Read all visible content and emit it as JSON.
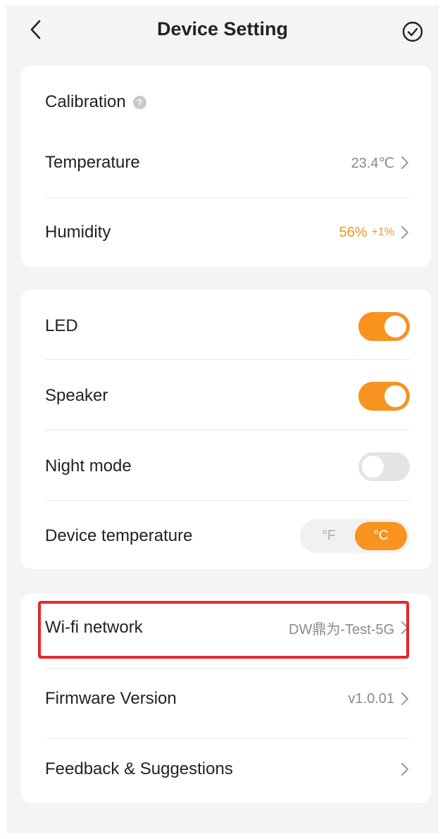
{
  "header": {
    "title": "Device Setting",
    "back_icon": "chevron-left-icon",
    "confirm_icon": "check-circle-icon"
  },
  "calibration": {
    "title": "Calibration",
    "help_icon": "?",
    "temperature": {
      "label": "Temperature",
      "value": "23.4℃"
    },
    "humidity": {
      "label": "Humidity",
      "value": "56%",
      "delta": "+1%"
    }
  },
  "controls": {
    "led": {
      "label": "LED",
      "on": true
    },
    "speaker": {
      "label": "Speaker",
      "on": true
    },
    "night_mode": {
      "label": "Night mode",
      "on": false
    },
    "device_temperature": {
      "label": "Device temperature",
      "options": [
        "°F",
        "°C"
      ],
      "selected": "°C"
    }
  },
  "info": {
    "wifi": {
      "label": "Wi-fi network",
      "value": "DW鼎为-Test-5G"
    },
    "firmware": {
      "label": "Firmware Version",
      "value": "v1.0.01"
    },
    "feedback": {
      "label": "Feedback & Suggestions"
    }
  },
  "colors": {
    "accent": "#f7931e",
    "highlight": "#e8262b",
    "background": "#f4f4f6"
  }
}
